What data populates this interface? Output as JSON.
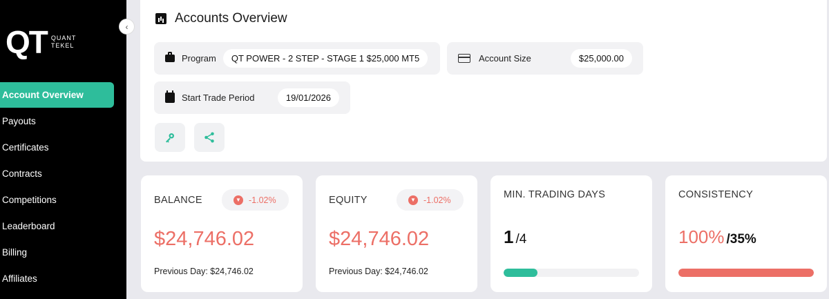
{
  "sidebar": {
    "logo_mark": "QT",
    "logo_line1": "QUANT",
    "logo_line2": "TEKEL",
    "collapse_glyph": "‹",
    "items": [
      {
        "label": "Account Overview",
        "active": true
      },
      {
        "label": "Payouts"
      },
      {
        "label": "Certificates"
      },
      {
        "label": "Contracts"
      },
      {
        "label": "Competitions"
      },
      {
        "label": "Leaderboard"
      },
      {
        "label": "Billing"
      },
      {
        "label": "Affiliates"
      }
    ]
  },
  "overview": {
    "title": "Accounts Overview",
    "program": {
      "label": "Program",
      "value": "QT POWER - 2 STEP - STAGE 1 $25,000 MT5"
    },
    "account_size": {
      "label": "Account Size",
      "value": "$25,000.00"
    },
    "start_trade": {
      "label": "Start Trade Period",
      "value": "19/01/2026"
    },
    "actions": [
      {
        "icon": "key-icon"
      },
      {
        "icon": "share-icon"
      }
    ]
  },
  "cards": {
    "balance": {
      "title": "BALANCE",
      "change": "-1.02%",
      "value": "$24,746.02",
      "previous": "Previous Day: $24,746.02"
    },
    "equity": {
      "title": "EQUITY",
      "change": "-1.02%",
      "value": "$24,746.02",
      "previous": "Previous Day: $24,746.02"
    },
    "min_days": {
      "title": "MIN. TRADING DAYS",
      "current": "1",
      "target": "/4",
      "progress": 0.25
    },
    "consistency": {
      "title": "CONSISTENCY",
      "current": "100%",
      "target": "/35%",
      "progress": 1.0
    }
  },
  "colors": {
    "accent": "#2ebd9b",
    "negative": "#ec6f66",
    "sidebar": "#000000"
  }
}
